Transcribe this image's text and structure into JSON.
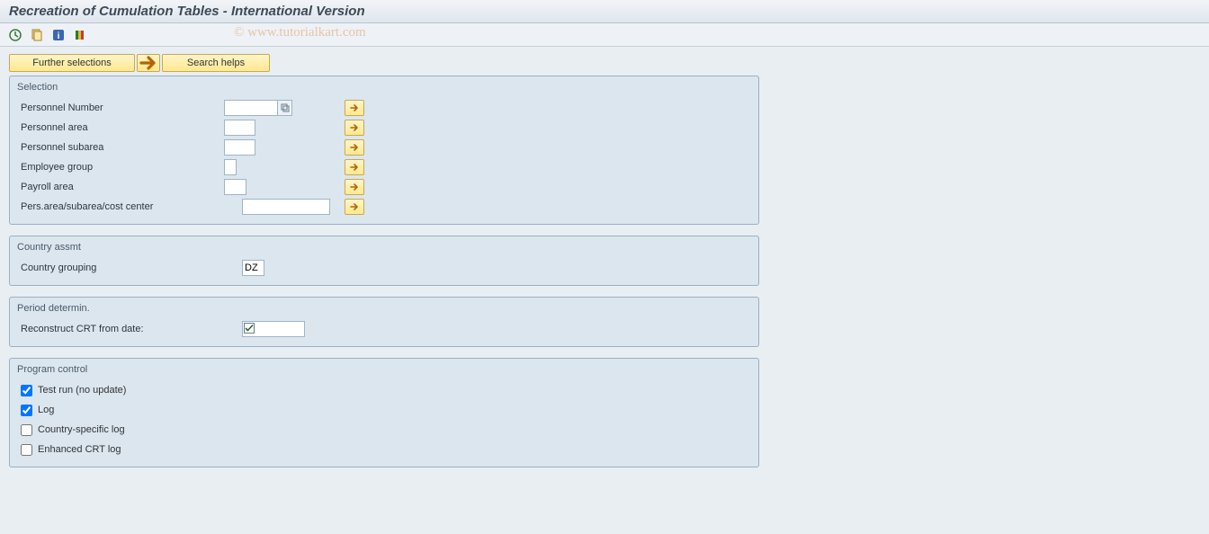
{
  "title": "Recreation of Cumulation Tables - International Version",
  "watermark": "© www.tutorialkart.com",
  "ribbon": {
    "further_selections": "Further selections",
    "search_helps": "Search helps"
  },
  "groups": {
    "selection": {
      "title": "Selection",
      "personnel_number_label": "Personnel Number",
      "personnel_number_value": "",
      "personnel_area_label": "Personnel area",
      "personnel_area_value": "",
      "personnel_subarea_label": "Personnel subarea",
      "personnel_subarea_value": "",
      "employee_group_label": "Employee group",
      "employee_group_value": "",
      "payroll_area_label": "Payroll area",
      "payroll_area_value": "",
      "pers_area_cost_label": "Pers.area/subarea/cost center",
      "pers_area_cost_value": ""
    },
    "country": {
      "title": "Country assmt",
      "country_grouping_label": "Country grouping",
      "country_grouping_value": "DZ"
    },
    "period": {
      "title": "Period determin.",
      "reconstruct_label": "Reconstruct CRT from date:",
      "reconstruct_value": ""
    },
    "program": {
      "title": "Program control",
      "test_run_label": "Test run (no update)",
      "test_run_checked": true,
      "log_label": "Log",
      "log_checked": true,
      "country_log_label": "Country-specific log",
      "country_log_checked": false,
      "enh_crt_log_label": "Enhanced CRT log",
      "enh_crt_log_checked": false
    }
  }
}
